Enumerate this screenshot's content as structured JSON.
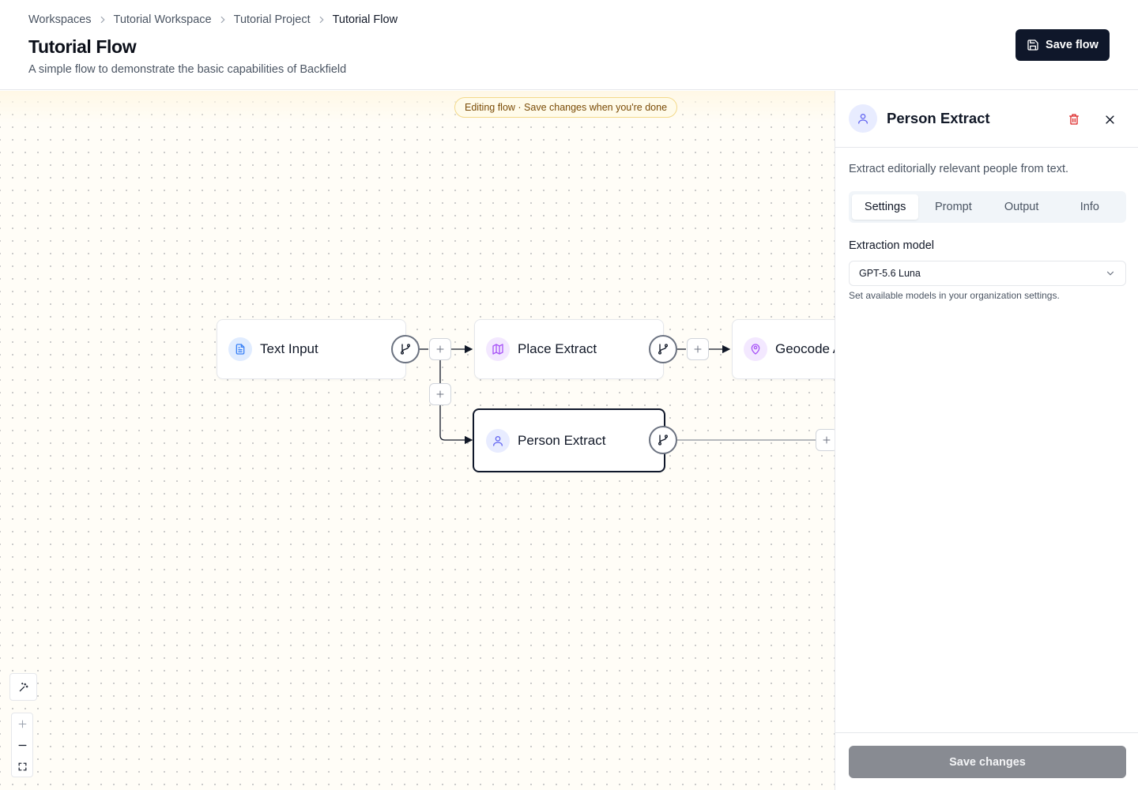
{
  "breadcrumb": {
    "items": [
      "Workspaces",
      "Tutorial Workspace",
      "Tutorial Project",
      "Tutorial Flow"
    ]
  },
  "header": {
    "title": "Tutorial Flow",
    "subtitle": "A simple flow to demonstrate the basic capabilities of Backfield",
    "save_label": "Save flow"
  },
  "canvas": {
    "banner": "Editing flow · Save changes when you're done",
    "nodes": [
      {
        "label": "Text Input",
        "icon": "document-icon",
        "color": "#3b82f6"
      },
      {
        "label": "Place Extract",
        "icon": "map-icon",
        "color": "#a855f7"
      },
      {
        "label": "Geocode A",
        "icon": "map-pin-user-icon",
        "color": "#a855f7"
      },
      {
        "label": "Person Extract",
        "icon": "user-icon",
        "color": "#6366f1",
        "selected": true
      }
    ]
  },
  "panel": {
    "title": "Person Extract",
    "description": "Extract editorially relevant people from text.",
    "tabs": [
      "Settings",
      "Prompt",
      "Output",
      "Info"
    ],
    "active_tab": "Settings",
    "field_label": "Extraction model",
    "model_value": "GPT-5.6 Luna",
    "hint": "Set available models in your organization settings.",
    "save_changes_label": "Save changes"
  },
  "colors": {
    "primary": "#0f172a",
    "delete": "#dc2626",
    "banner_text": "#7a4b06",
    "disabled_button": "#888b92"
  }
}
